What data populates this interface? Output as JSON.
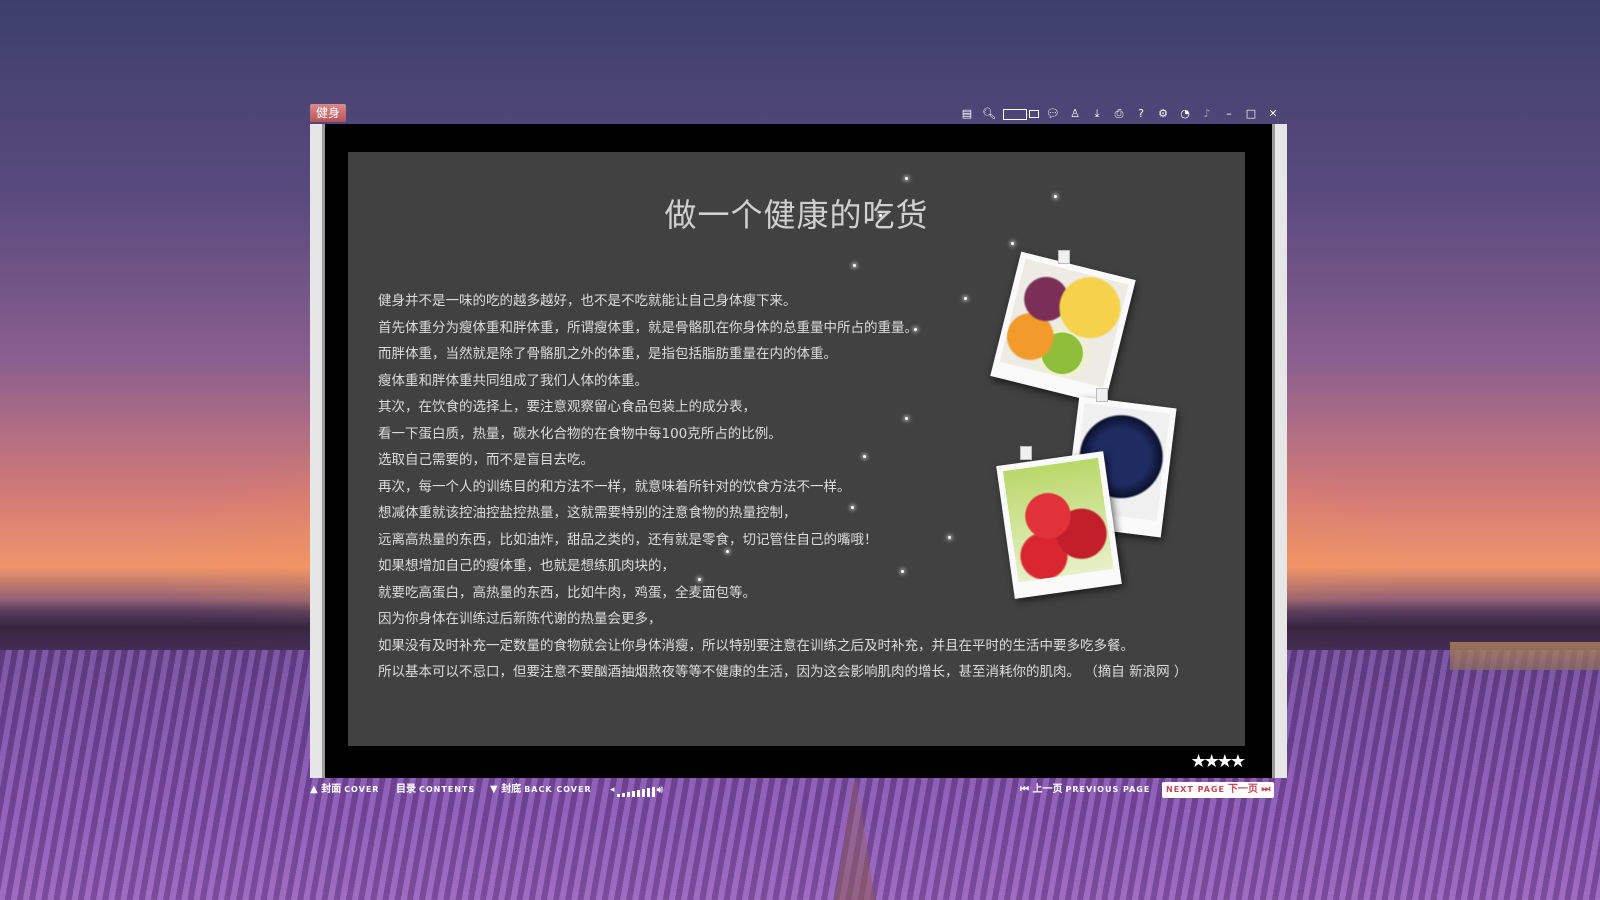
{
  "window": {
    "title": "健身",
    "toolbar_icons": [
      "page-icon",
      "zoom-icon",
      "view-mode-icon",
      "comment-icon",
      "user-icon",
      "download-icon",
      "print-icon",
      "help-icon",
      "settings-icon",
      "clock-icon",
      "music-icon",
      "minimize-icon",
      "maximize-icon",
      "close-icon"
    ]
  },
  "page": {
    "title": "做一个健康的吃货",
    "paragraphs": [
      "健身并不是一味的吃的越多越好，也不是不吃就能让自己身体瘦下来。",
      "首先体重分为瘦体重和胖体重，所谓瘦体重，就是骨骼肌在你身体的总重量中所占的重量。",
      "而胖体重，当然就是除了骨骼肌之外的体重，是指包括脂肪重量在内的体重。",
      "瘦体重和胖体重共同组成了我们人体的体重。",
      "其次，在饮食的选择上，要注意观察留心食品包装上的成分表，",
      "看一下蛋白质，热量，碳水化合物的在食物中每100克所占的比例。",
      "选取自己需要的，而不是盲目去吃。",
      "再次，每一个人的训练目的和方法不一样，就意味着所针对的饮食方法不一样。",
      "想减体重就该控油控盐控热量，这就需要特别的注意食物的热量控制，",
      "远离高热量的东西，比如油炸，甜品之类的，还有就是零食，切记管住自己的嘴哦！",
      "如果想增加自己的瘦体重，也就是想练肌肉块的，",
      "就要吃高蛋白，高热量的东西，比如牛肉，鸡蛋，全麦面包等。",
      "因为你身体在训练过后新陈代谢的热量会更多，",
      "如果没有及时补充一定数量的食物就会让你身体消瘦，所以特别要注意在训练之后及时补充，并且在平时的生活中要多吃多餐。",
      "所以基本可以不忌口，但要注意不要酗酒抽烟熬夜等等不健康的生活，因为这会影响肌肉的增长，甚至消耗你的肌肉。    （摘自 新浪网 ）"
    ],
    "photos": [
      "fruit-platter-photo",
      "grapes-photo",
      "apples-photo"
    ]
  },
  "nav": {
    "cover_cn": "封面",
    "cover_en": "COVER",
    "contents_cn": "目录",
    "contents_en": "CONTENTS",
    "back_cn": "封底",
    "back_en": "BACK COVER",
    "prev_cn": "上一页",
    "prev_en": "PREVIOUS PAGE",
    "next_en": "NEXT PAGE",
    "next_cn": "下一页"
  },
  "colors": {
    "accent": "#c24a55",
    "page_bg": "#414141",
    "frame": "#e6e6e6"
  }
}
